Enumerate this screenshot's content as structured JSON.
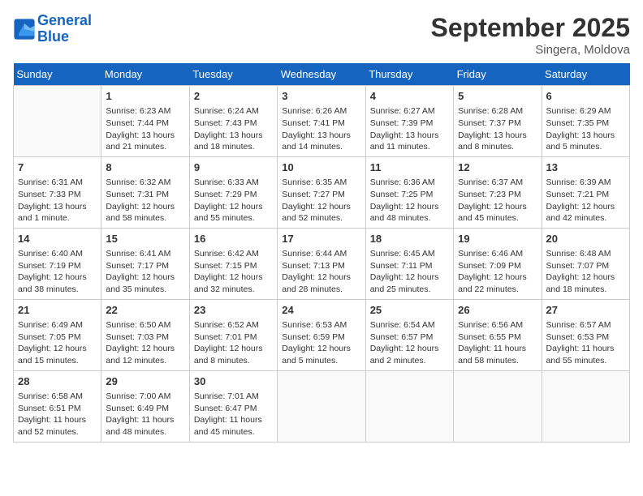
{
  "header": {
    "logo_line1": "General",
    "logo_line2": "Blue",
    "month": "September 2025",
    "location": "Singera, Moldova"
  },
  "weekdays": [
    "Sunday",
    "Monday",
    "Tuesday",
    "Wednesday",
    "Thursday",
    "Friday",
    "Saturday"
  ],
  "weeks": [
    [
      {
        "day": "",
        "content": ""
      },
      {
        "day": "1",
        "content": "Sunrise: 6:23 AM\nSunset: 7:44 PM\nDaylight: 13 hours and 21 minutes."
      },
      {
        "day": "2",
        "content": "Sunrise: 6:24 AM\nSunset: 7:43 PM\nDaylight: 13 hours and 18 minutes."
      },
      {
        "day": "3",
        "content": "Sunrise: 6:26 AM\nSunset: 7:41 PM\nDaylight: 13 hours and 14 minutes."
      },
      {
        "day": "4",
        "content": "Sunrise: 6:27 AM\nSunset: 7:39 PM\nDaylight: 13 hours and 11 minutes."
      },
      {
        "day": "5",
        "content": "Sunrise: 6:28 AM\nSunset: 7:37 PM\nDaylight: 13 hours and 8 minutes."
      },
      {
        "day": "6",
        "content": "Sunrise: 6:29 AM\nSunset: 7:35 PM\nDaylight: 13 hours and 5 minutes."
      }
    ],
    [
      {
        "day": "7",
        "content": "Sunrise: 6:31 AM\nSunset: 7:33 PM\nDaylight: 13 hours and 1 minute."
      },
      {
        "day": "8",
        "content": "Sunrise: 6:32 AM\nSunset: 7:31 PM\nDaylight: 12 hours and 58 minutes."
      },
      {
        "day": "9",
        "content": "Sunrise: 6:33 AM\nSunset: 7:29 PM\nDaylight: 12 hours and 55 minutes."
      },
      {
        "day": "10",
        "content": "Sunrise: 6:35 AM\nSunset: 7:27 PM\nDaylight: 12 hours and 52 minutes."
      },
      {
        "day": "11",
        "content": "Sunrise: 6:36 AM\nSunset: 7:25 PM\nDaylight: 12 hours and 48 minutes."
      },
      {
        "day": "12",
        "content": "Sunrise: 6:37 AM\nSunset: 7:23 PM\nDaylight: 12 hours and 45 minutes."
      },
      {
        "day": "13",
        "content": "Sunrise: 6:39 AM\nSunset: 7:21 PM\nDaylight: 12 hours and 42 minutes."
      }
    ],
    [
      {
        "day": "14",
        "content": "Sunrise: 6:40 AM\nSunset: 7:19 PM\nDaylight: 12 hours and 38 minutes."
      },
      {
        "day": "15",
        "content": "Sunrise: 6:41 AM\nSunset: 7:17 PM\nDaylight: 12 hours and 35 minutes."
      },
      {
        "day": "16",
        "content": "Sunrise: 6:42 AM\nSunset: 7:15 PM\nDaylight: 12 hours and 32 minutes."
      },
      {
        "day": "17",
        "content": "Sunrise: 6:44 AM\nSunset: 7:13 PM\nDaylight: 12 hours and 28 minutes."
      },
      {
        "day": "18",
        "content": "Sunrise: 6:45 AM\nSunset: 7:11 PM\nDaylight: 12 hours and 25 minutes."
      },
      {
        "day": "19",
        "content": "Sunrise: 6:46 AM\nSunset: 7:09 PM\nDaylight: 12 hours and 22 minutes."
      },
      {
        "day": "20",
        "content": "Sunrise: 6:48 AM\nSunset: 7:07 PM\nDaylight: 12 hours and 18 minutes."
      }
    ],
    [
      {
        "day": "21",
        "content": "Sunrise: 6:49 AM\nSunset: 7:05 PM\nDaylight: 12 hours and 15 minutes."
      },
      {
        "day": "22",
        "content": "Sunrise: 6:50 AM\nSunset: 7:03 PM\nDaylight: 12 hours and 12 minutes."
      },
      {
        "day": "23",
        "content": "Sunrise: 6:52 AM\nSunset: 7:01 PM\nDaylight: 12 hours and 8 minutes."
      },
      {
        "day": "24",
        "content": "Sunrise: 6:53 AM\nSunset: 6:59 PM\nDaylight: 12 hours and 5 minutes."
      },
      {
        "day": "25",
        "content": "Sunrise: 6:54 AM\nSunset: 6:57 PM\nDaylight: 12 hours and 2 minutes."
      },
      {
        "day": "26",
        "content": "Sunrise: 6:56 AM\nSunset: 6:55 PM\nDaylight: 11 hours and 58 minutes."
      },
      {
        "day": "27",
        "content": "Sunrise: 6:57 AM\nSunset: 6:53 PM\nDaylight: 11 hours and 55 minutes."
      }
    ],
    [
      {
        "day": "28",
        "content": "Sunrise: 6:58 AM\nSunset: 6:51 PM\nDaylight: 11 hours and 52 minutes."
      },
      {
        "day": "29",
        "content": "Sunrise: 7:00 AM\nSunset: 6:49 PM\nDaylight: 11 hours and 48 minutes."
      },
      {
        "day": "30",
        "content": "Sunrise: 7:01 AM\nSunset: 6:47 PM\nDaylight: 11 hours and 45 minutes."
      },
      {
        "day": "",
        "content": ""
      },
      {
        "day": "",
        "content": ""
      },
      {
        "day": "",
        "content": ""
      },
      {
        "day": "",
        "content": ""
      }
    ]
  ]
}
